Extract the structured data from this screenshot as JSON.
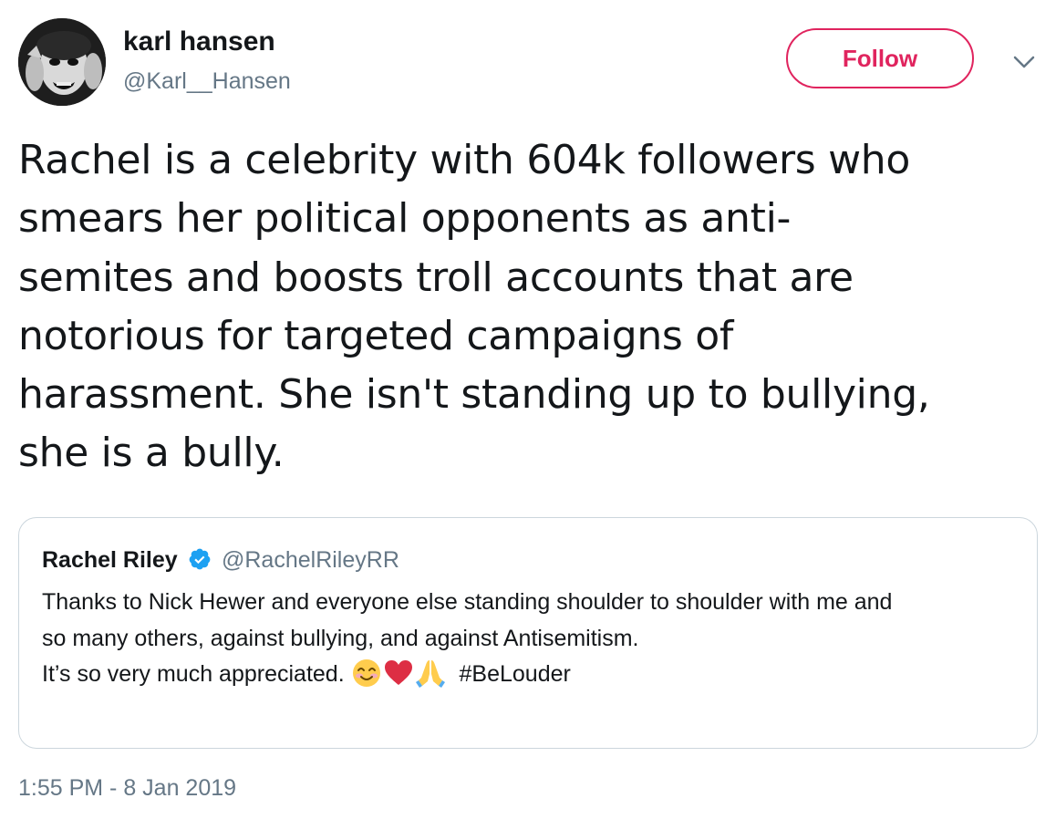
{
  "author": {
    "display_name": "karl hansen",
    "handle": "@Karl__Hansen"
  },
  "follow_button": {
    "label": "Follow",
    "color": "#e0245e"
  },
  "tweet": {
    "text_lines": [
      "Rachel is a celebrity with 604k followers who",
      "smears her political opponents as anti-",
      "semites and boosts troll accounts that are",
      "notorious for targeted campaigns of",
      "harassment. She isn't standing up to bullying,",
      "she is a bully."
    ],
    "timestamp": "1:55 PM - 8 Jan 2019"
  },
  "quoted_tweet": {
    "display_name": "Rachel Riley",
    "verified": true,
    "handle": "@RachelRileyRR",
    "text_lines": [
      "Thanks to Nick Hewer and everyone else standing shoulder to shoulder with me and",
      "so many others, against bullying, and against Antisemitism.",
      "It’s so very much appreciated. "
    ],
    "emojis": [
      "smiling-face-icon",
      "heart-icon",
      "folded-hands-icon"
    ],
    "hashtag": "#BeLouder"
  },
  "colors": {
    "text": "#14171a",
    "secondary": "#657786",
    "border": "#ccd6dd",
    "verified": "#1da1f2"
  }
}
